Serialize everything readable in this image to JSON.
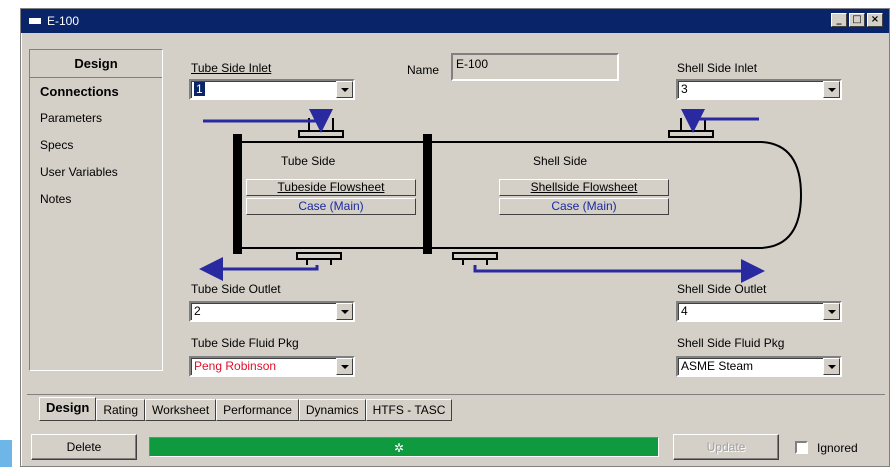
{
  "window": {
    "title": "E-100"
  },
  "sidebar": {
    "header": "Design",
    "items": [
      "Connections",
      "Parameters",
      "Specs",
      "User Variables",
      "Notes"
    ]
  },
  "form": {
    "tube_side_inlet": {
      "label": "Tube Side Inlet",
      "value": "1"
    },
    "name": {
      "label": "Name",
      "value": "E-100"
    },
    "shell_side_inlet": {
      "label": "Shell Side Inlet",
      "value": "3"
    },
    "tube_side_outlet": {
      "label": "Tube Side Outlet",
      "value": "2"
    },
    "shell_side_outlet": {
      "label": "Shell Side Outlet",
      "value": "4"
    },
    "tube_side_fluid_pkg": {
      "label": "Tube Side Fluid Pkg",
      "value": "Peng Robinson"
    },
    "shell_side_fluid_pkg": {
      "label": "Shell Side Fluid Pkg",
      "value": "ASME Steam"
    }
  },
  "diagram": {
    "tube_side_title": "Tube Side",
    "shell_side_title": "Shell Side",
    "tubeside_flowsheet": "Tubeside Flowsheet",
    "tubeside_case": "Case (Main)",
    "shellside_flowsheet": "Shellside Flowsheet",
    "shellside_case": "Case (Main)",
    "stream_color": "#2a2aa0"
  },
  "tabs": [
    "Design",
    "Rating",
    "Worksheet",
    "Performance",
    "Dynamics",
    "HTFS - TASC"
  ],
  "bottom": {
    "delete_label": "Delete",
    "update_label": "Update",
    "ignored_label": "Ignored",
    "status_color": "#0f9a3f"
  }
}
